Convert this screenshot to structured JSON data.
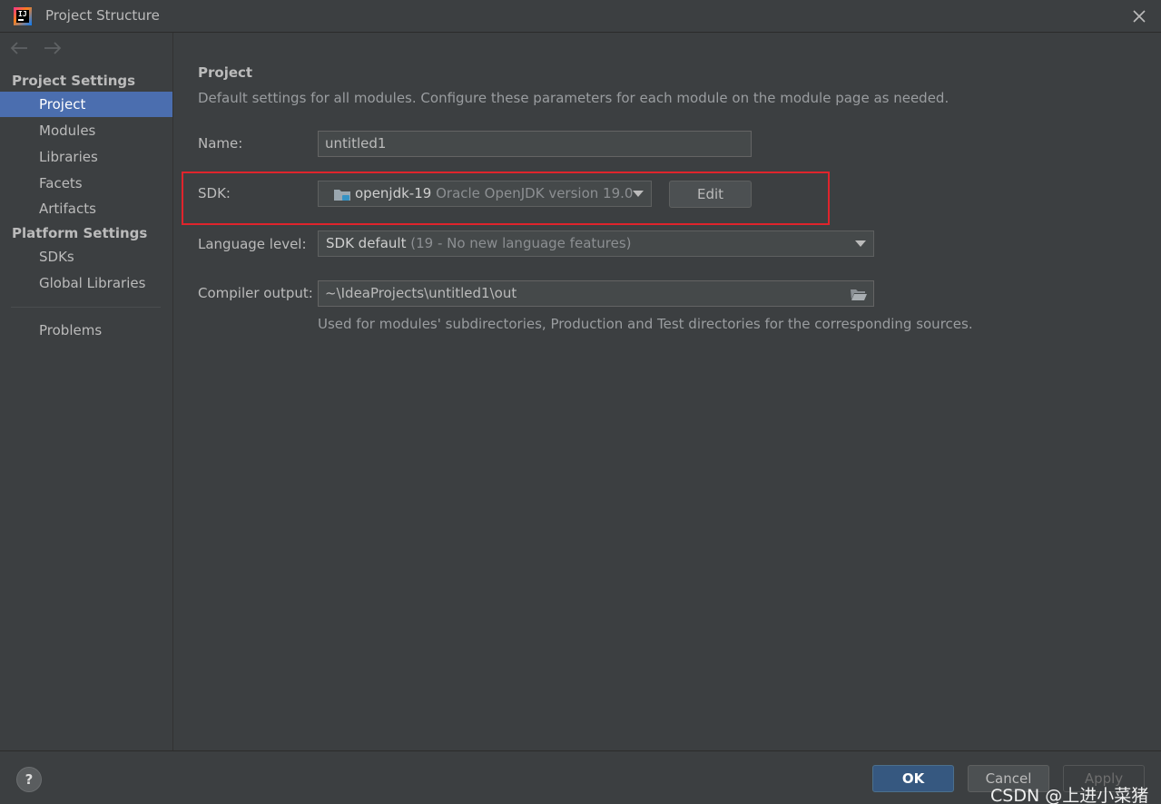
{
  "window": {
    "title": "Project Structure"
  },
  "sidebar": {
    "project_settings_header": "Project Settings",
    "project_items": [
      {
        "label": "Project",
        "selected": true
      },
      {
        "label": "Modules"
      },
      {
        "label": "Libraries"
      },
      {
        "label": "Facets"
      },
      {
        "label": "Artifacts"
      }
    ],
    "platform_settings_header": "Platform Settings",
    "platform_items": [
      {
        "label": "SDKs"
      },
      {
        "label": "Global Libraries"
      }
    ],
    "problems_label": "Problems"
  },
  "main": {
    "title": "Project",
    "description": "Default settings for all modules. Configure these parameters for each module on the module page as needed.",
    "name": {
      "label": "Name:",
      "value": "untitled1"
    },
    "sdk": {
      "label": "SDK:",
      "selected_name": "openjdk-19",
      "selected_detail": "Oracle OpenJDK version 19.0",
      "edit_label": "Edit"
    },
    "language_level": {
      "label": "Language level:",
      "selected_name": "SDK default",
      "selected_detail": "(19 - No new language features)"
    },
    "compiler_output": {
      "label": "Compiler output:",
      "value": "~\\IdeaProjects\\untitled1\\out",
      "hint": "Used for modules' subdirectories, Production and Test directories for the corresponding sources."
    }
  },
  "footer": {
    "help_label": "?",
    "ok_label": "OK",
    "cancel_label": "Cancel",
    "apply_label": "Apply"
  },
  "watermark": "CSDN @上进小菜猪",
  "colors": {
    "background": "#3c3f41",
    "selection": "#4b6eaf",
    "ok_button": "#365880",
    "highlight_box": "#e0242c"
  }
}
